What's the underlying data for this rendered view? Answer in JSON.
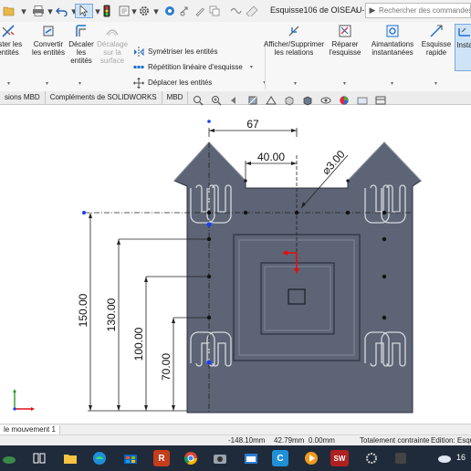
{
  "window": {
    "title": "Esquisse106 de OISEAU-1 *",
    "search_placeholder": "Rechercher des commandes"
  },
  "ribbon": {
    "ajuster": "uster les\nentités",
    "convertir": "Convertir\nles entités",
    "decaler": "Décaler\nles\nentités",
    "decalage_surface": "Décalage\nsur la\nsurface",
    "symetriser": "Symétriser les entités",
    "repetition": "Répétition linéaire d'esquisse",
    "deplacer": "Déplacer les entités",
    "afficher_relations": "Afficher/Supprimer\nles relations",
    "reparer": "Réparer\nl'esquisse",
    "aimantations": "Aimantations\ninstantanées",
    "esquisse_rapide": "Esquisse\nrapide",
    "instant": "Insta"
  },
  "tabs": [
    "sions MBD",
    "Compléments de SOLIDWORKS",
    "MBD"
  ],
  "drawing": {
    "dim_67": "67",
    "dim_40": "40.00",
    "dim_dia": "⌀3.00",
    "dim_150": "150.00",
    "dim_130": "130.00",
    "dim_100": "100.00",
    "dim_70": "70.00"
  },
  "statusbar": {
    "tab": "le mouvement 1",
    "x": "-148.10mm",
    "y": "42.79mm",
    "z": "0.00mm",
    "status": "Totalement contrainte",
    "edition": "Edition: Esqu"
  },
  "taskbar": {
    "clock": "16"
  },
  "colors": {
    "part_fill": "#5c6475",
    "part_stroke": "#2c3140",
    "dimension": "#222222",
    "blue_point": "#1a3cff",
    "red_arrow": "#e01010"
  }
}
